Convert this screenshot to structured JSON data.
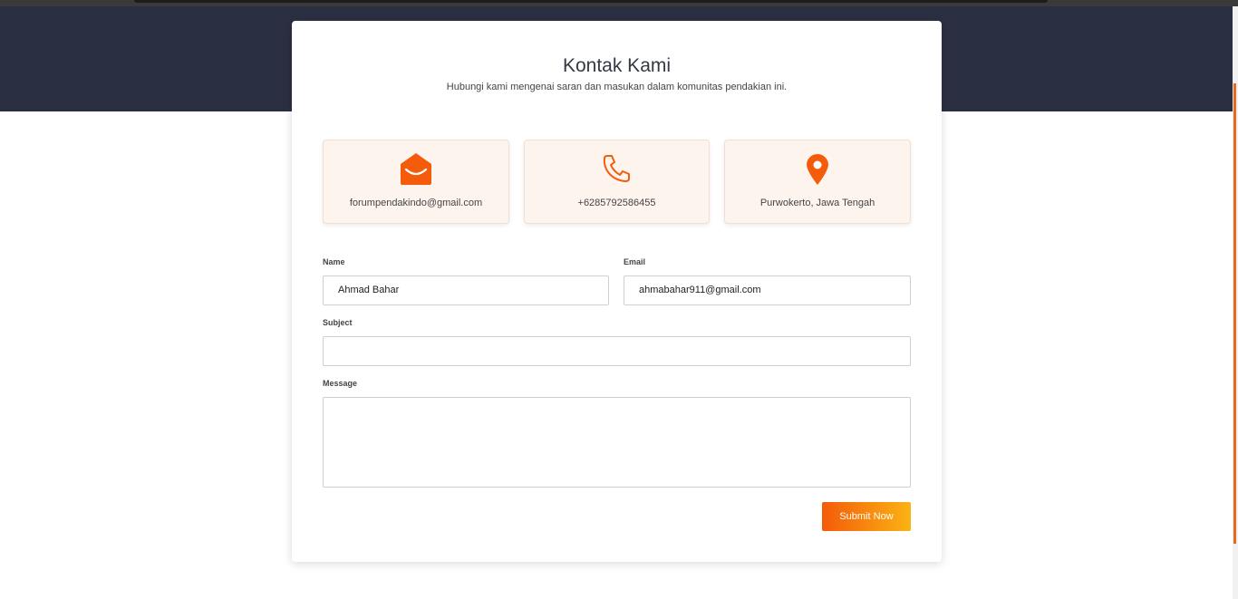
{
  "contact": {
    "title": "Kontak Kami",
    "subtitle": "Hubungi kami mengenai saran dan masukan dalam komunitas pendakian ini.",
    "info": [
      {
        "icon": "envelope-icon",
        "text": "forumpendakindo@gmail.com"
      },
      {
        "icon": "phone-icon",
        "text": "+6285792586455"
      },
      {
        "icon": "location-pin-icon",
        "text": "Purwokerto, Jawa Tengah"
      }
    ]
  },
  "form": {
    "name_label": "Name",
    "name_value": "Ahmad Bahar",
    "email_label": "Email",
    "email_value": "ahmabahar911@gmail.com",
    "subject_label": "Subject",
    "subject_value": "",
    "message_label": "Message",
    "message_value": "",
    "submit_label": "Submit Now"
  },
  "colors": {
    "accent": "#f45b0a",
    "accent_end": "#fbb313",
    "hero_bg": "#2b2f42",
    "info_bg": "#fdf4ee"
  }
}
